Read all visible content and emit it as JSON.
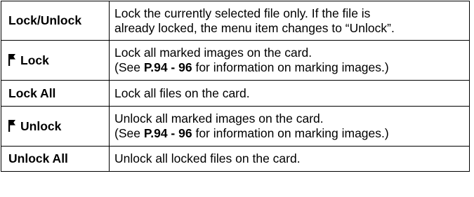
{
  "rows": [
    {
      "label": "Lock/Unlock",
      "icon": null,
      "description_lines": [
        "Lock the currently selected file only. If the file is",
        "already locked, the menu item changes to “Unlock”."
      ]
    },
    {
      "label": "Lock",
      "icon": "flag-icon",
      "description_lines": [
        "Lock all marked images on the card."
      ],
      "note": {
        "prefix": "(See ",
        "ref": "P.94 - 96",
        "suffix": " for information on marking images.)"
      }
    },
    {
      "label": "Lock All",
      "icon": null,
      "description_lines": [
        "Lock all files on the card."
      ]
    },
    {
      "label": "Unlock",
      "icon": "flag-icon",
      "description_lines": [
        "Unlock all marked images on the card."
      ],
      "note": {
        "prefix": "(See ",
        "ref": "P.94 - 96",
        "suffix": " for information on marking images.)"
      }
    },
    {
      "label": "Unlock All",
      "icon": null,
      "description_lines": [
        "Unlock all locked files on the card."
      ]
    }
  ]
}
